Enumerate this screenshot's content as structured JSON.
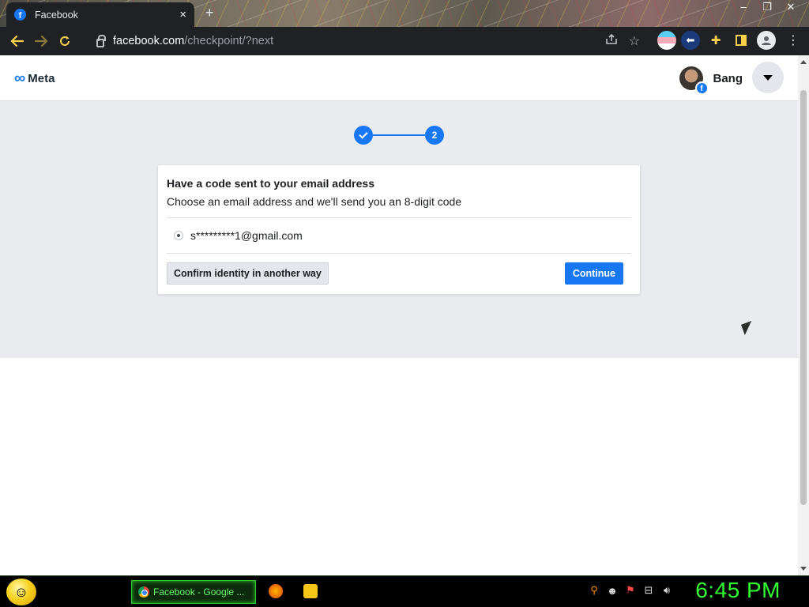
{
  "browser": {
    "tab": {
      "title": "Facebook",
      "favicon": "f",
      "close": "×"
    },
    "new_tab": "+",
    "window_controls": [
      "–",
      "❐",
      "✕"
    ],
    "url": {
      "host": "facebook.com",
      "path": "/checkpoint/?next"
    }
  },
  "header": {
    "brand": "Meta",
    "user": {
      "name": "Bang",
      "badge": "f"
    }
  },
  "stepper": {
    "step2_label": "2"
  },
  "card": {
    "title": "Have a code sent to your email address",
    "subtitle": "Choose an email address and we'll send you an 8-digit code",
    "email_option": "s*********1@gmail.com",
    "secondary_button": "Confirm identity in another way",
    "primary_button": "Continue"
  },
  "taskbar": {
    "active_window": "Facebook - Google ...",
    "clock": "6:45 PM"
  },
  "colors": {
    "accent": "#1877f2",
    "page_bg": "#e9ebee",
    "clock": "#32ff32"
  }
}
